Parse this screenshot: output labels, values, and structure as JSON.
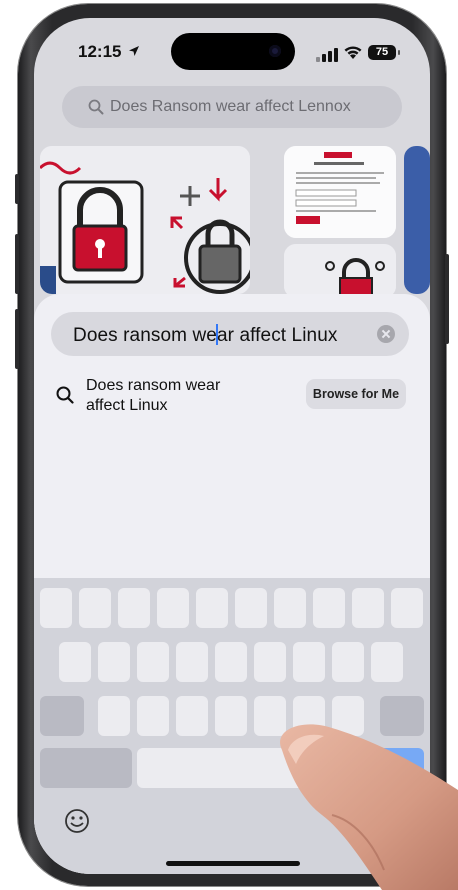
{
  "status_bar": {
    "time": "12:15",
    "battery": "75"
  },
  "background_page": {
    "search_text": "Does Ransom wear affect Lennox"
  },
  "search_sheet": {
    "query_value": "Does ransom wear affect Linux",
    "query_before_caret": "Does ransom we",
    "query_after_caret": "ar affect Linux",
    "suggestion_line1": "Does ransom wear",
    "suggestion_line2": "affect Linux",
    "browse_label": "Browse for Me"
  },
  "colors": {
    "caret": "#3478f6",
    "sheet_bg": "#efeff4",
    "key_bg": "#ececf0",
    "return_key": "#77a9f5"
  },
  "icons": [
    "search-icon",
    "clear-icon",
    "emoji-icon",
    "location-arrow-icon",
    "signal-icon",
    "wifi-icon",
    "battery-icon"
  ]
}
